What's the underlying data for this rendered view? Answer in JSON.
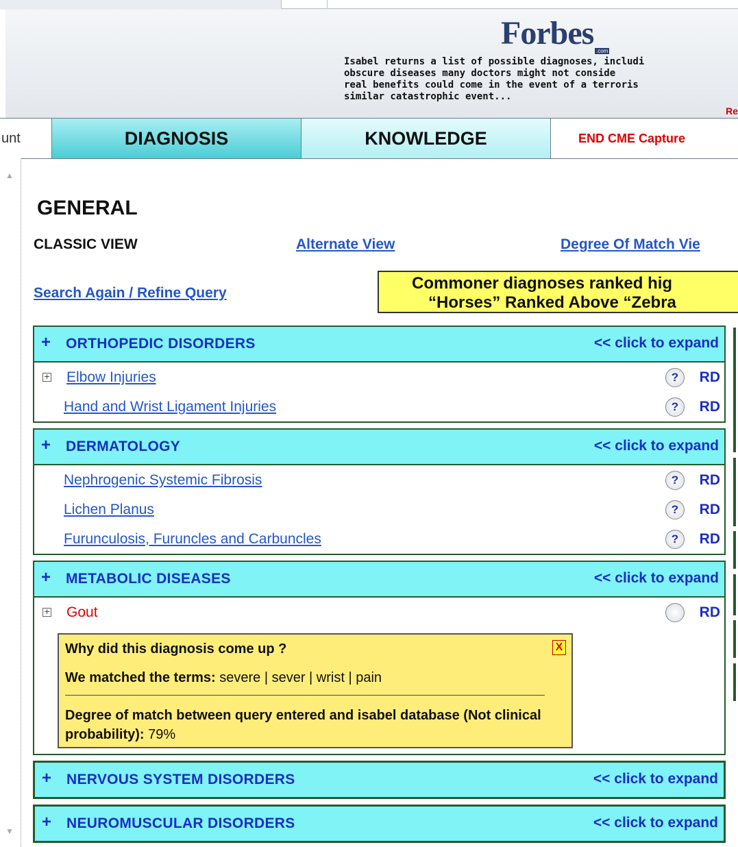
{
  "banner": {
    "logo": "Forbes",
    "logo_sub": ".com",
    "quote_lines": [
      "Isabel returns a list of possible diagnoses, includi",
      "obscure diseases many doctors might not conside",
      "real benefits could come in the event of a terroris",
      "similar catastrophic event..."
    ],
    "read_more": "Re"
  },
  "nav": {
    "account": "unt",
    "diagnosis": "DIAGNOSIS",
    "knowledge": "KNOWLEDGE",
    "cme": "END CME Capture"
  },
  "page": {
    "title": "GENERAL",
    "classic_view": "CLASSIC VIEW",
    "alternate_view": "Alternate View",
    "degree_view": "Degree Of Match Vie",
    "search_again": "Search Again / Refine Query",
    "note_line1": "Commoner diagnoses ranked hig",
    "note_line2": "“Horses” Ranked Above “Zebra"
  },
  "groups": [
    {
      "title": "ORTHOPEDIC DISORDERS",
      "expand": "<< click to expand",
      "items": [
        {
          "label": "Elbow Injuries",
          "help": "?",
          "rd": "RD"
        },
        {
          "label": "Hand and Wrist Ligament Injuries",
          "help": "?",
          "rd": "RD"
        }
      ]
    },
    {
      "title": "DERMATOLOGY",
      "expand": "<< click to expand",
      "items": [
        {
          "label": "Nephrogenic Systemic Fibrosis",
          "help": "?",
          "rd": "RD"
        },
        {
          "label": "Lichen Planus",
          "help": "?",
          "rd": "RD"
        },
        {
          "label": "Furunculosis, Furuncles and Carbuncles",
          "help": "?",
          "rd": "RD"
        }
      ]
    },
    {
      "title": "METABOLIC DISEASES",
      "expand": "<< click to expand",
      "items": [
        {
          "label": "Gout",
          "rd": "RD"
        }
      ]
    },
    {
      "title": "NERVOUS SYSTEM DISORDERS",
      "expand": "<< click to expand"
    },
    {
      "title": "NEUROMUSCULAR DISORDERS",
      "expand": "<< click to expand"
    }
  ],
  "why_box": {
    "title": "Why did this diagnosis come up ?",
    "close": "X",
    "matched_label": "We matched the terms:",
    "matched_terms": "severe | sever | wrist | pain",
    "degree_label": "Degree of match between query entered and isabel database (Not clinical probability):",
    "degree_value": "79%"
  },
  "icons": {
    "plus": "+",
    "tree_expand": "+"
  },
  "colors": {
    "accent_cyan": "#7ff3f6",
    "link_blue": "#2456c8",
    "header_blue": "#1a2ec0",
    "alert_red": "#e60000",
    "note_yellow": "#ffff66"
  }
}
